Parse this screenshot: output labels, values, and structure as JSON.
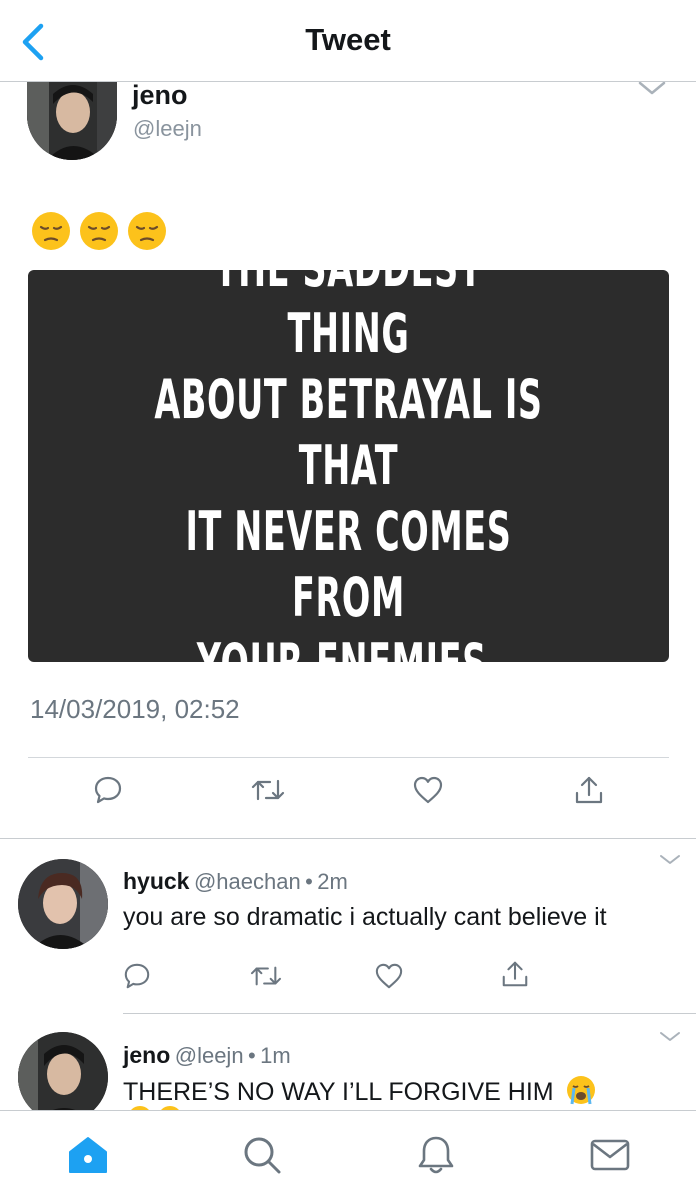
{
  "header": {
    "title": "Tweet"
  },
  "tweet": {
    "author_name": "jeno",
    "author_handle": "@leejn",
    "emojis": [
      "pensive-face",
      "pensive-face",
      "pensive-face"
    ],
    "image_text_lines": [
      "THE SADDEST THING",
      "ABOUT BETRAYAL IS THAT",
      "IT NEVER COMES FROM",
      "YOUR ENEMIES."
    ],
    "timestamp": "14/03/2019, 02:52",
    "actions": [
      "reply-icon",
      "retweet-icon",
      "like-icon",
      "share-icon"
    ]
  },
  "replies": [
    {
      "name": "hyuck",
      "handle": "@haechan",
      "time": "2m",
      "text": "you are so dramatic i actually cant believe it"
    },
    {
      "name": "jeno",
      "handle": "@leejn",
      "time": "1m",
      "text": "THERE’S NO WAY I’LL FORGIVE HIM",
      "trailing_emoji": "loudly-crying-face"
    }
  ],
  "tabbar": {
    "items": [
      "home-icon",
      "search-icon",
      "notifications-icon",
      "messages-icon"
    ],
    "active": "home-icon"
  },
  "colors": {
    "accent": "#1da1f2",
    "text": "#14171a",
    "muted": "#6b7680",
    "divider": "#c8ccd0",
    "card": "#2c2c2c"
  }
}
